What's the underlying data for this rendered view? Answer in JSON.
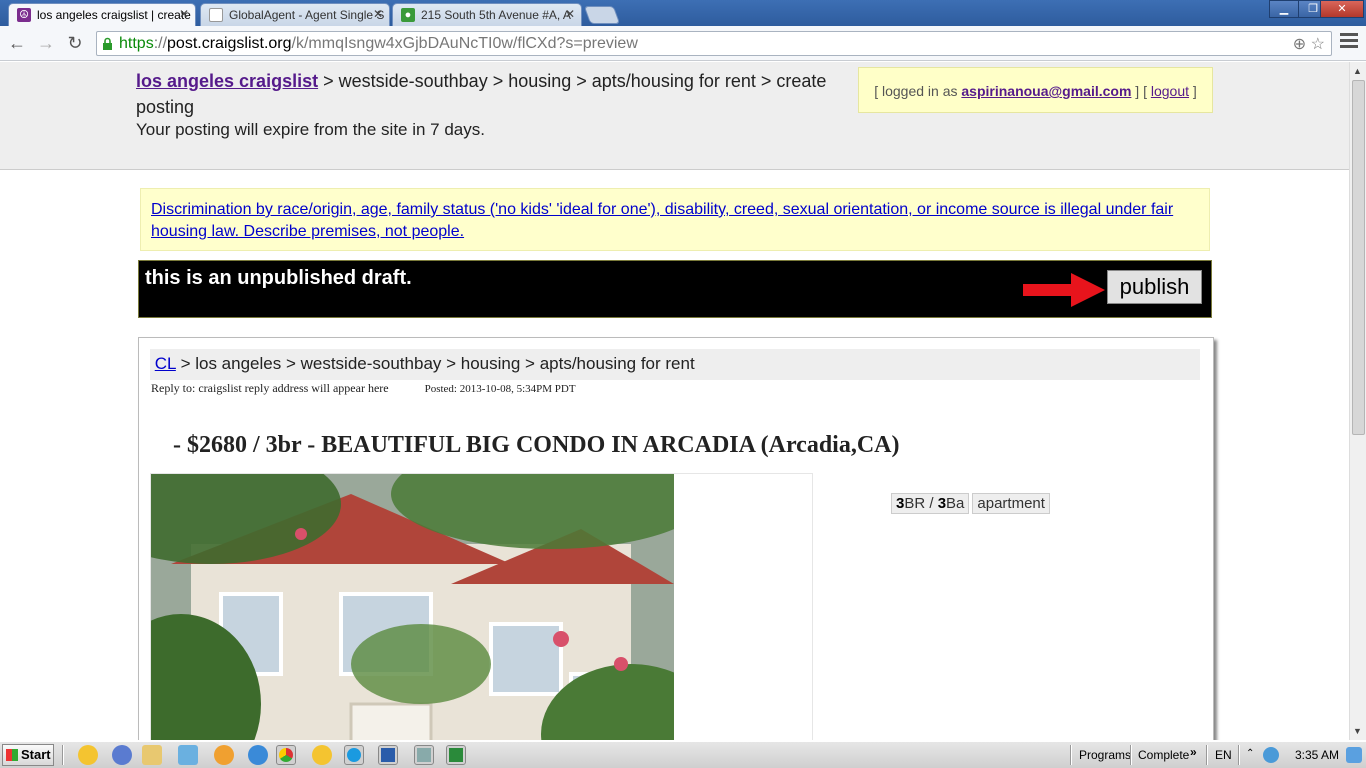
{
  "browser": {
    "tabs": [
      {
        "title": "los angeles craigslist | create",
        "active": true,
        "icon": "peace-icon"
      },
      {
        "title": "GlobalAgent - Agent Single S",
        "active": false,
        "icon": "page-icon"
      },
      {
        "title": "215 South 5th Avenue #A, A",
        "active": false,
        "icon": "map-pin-icon"
      }
    ],
    "url": {
      "scheme": "https",
      "separator": "://",
      "host": "post.craigslist.org",
      "path": "/k/mmqIsngw4xGjbDAuNcTI0w/flCXd?s=preview"
    },
    "window_buttons": [
      "minimize",
      "restore",
      "close"
    ]
  },
  "header": {
    "site_link": "los angeles craigslist",
    "breadcrumb_rest": " > westside-southbay > housing > apts/housing for rent > create posting",
    "expire_notice": "Your posting will expire from the site in 7 days.",
    "login": {
      "prefix": "[ logged in as ",
      "email": "aspirinanoua@gmail.com",
      "middle": " ] [ ",
      "logout": "logout",
      "suffix": " ]"
    }
  },
  "fair_housing_notice": "Discrimination by race/origin, age, family status ('no kids' 'ideal for one'), disability, creed, sexual orientation, or income source is illegal under fair housing law. Describe premises, not people.",
  "draft": {
    "message": "this is an unpublished draft.",
    "publish_label": "publish",
    "arrow_color": "#e8141c"
  },
  "posting": {
    "breadcrumb": {
      "root": "CL",
      "rest": " > los angeles > westside-southbay > housing > apts/housing for rent"
    },
    "reply_to": "Reply to: craigslist reply address will appear here",
    "posted": "Posted: 2013-10-08, 5:34PM PDT",
    "title": "- $2680 / 3br - BEAUTIFUL BIG CONDO IN ARCADIA (Arcadia,CA)",
    "attributes": {
      "br_num": "3",
      "br_label": "BR / ",
      "ba_num": "3",
      "ba_label": "Ba",
      "housing_type": "apartment"
    }
  },
  "taskbar": {
    "start_label": "Start",
    "tray": {
      "programs": "Programs",
      "complete": "Complete",
      "chevron": "»",
      "language": "EN",
      "time": "3:35 AM"
    }
  }
}
